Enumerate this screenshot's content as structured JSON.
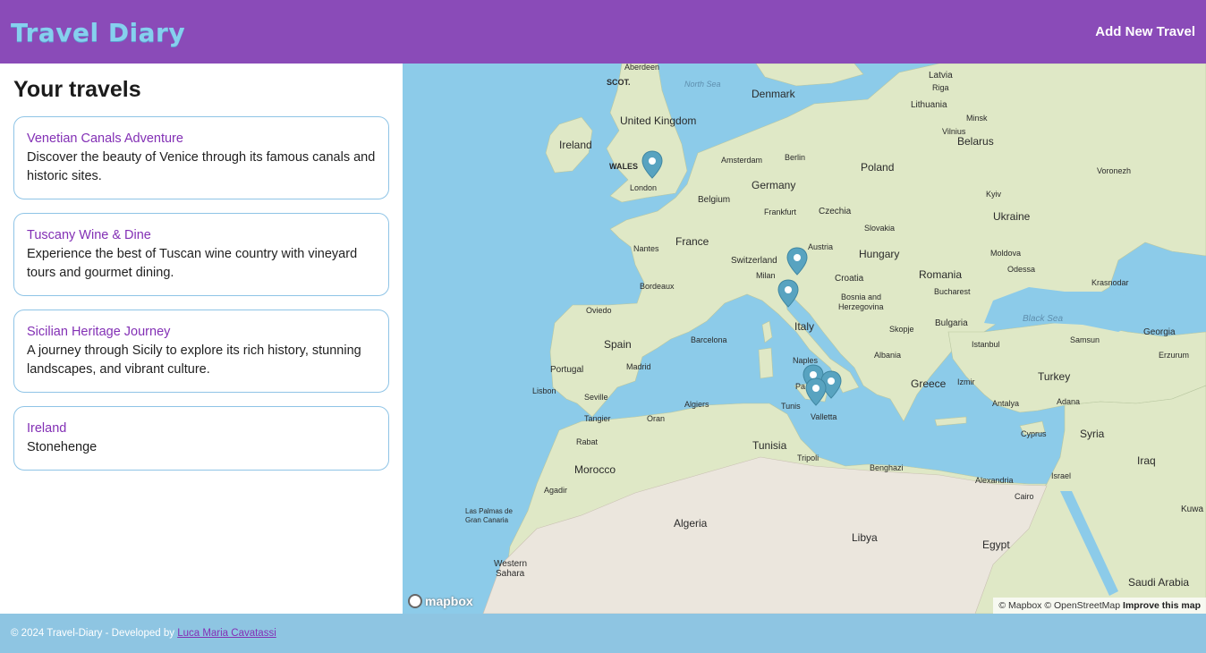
{
  "header": {
    "logo": "Travel Diary",
    "add_label": "Add New Travel"
  },
  "sidebar": {
    "heading": "Your travels",
    "travels": [
      {
        "title": "Venetian Canals Adventure",
        "description": "Discover the beauty of Venice through its famous canals and historic sites."
      },
      {
        "title": "Tuscany Wine & Dine",
        "description": "Experience the best of Tuscan wine country with vineyard tours and gourmet dining."
      },
      {
        "title": "Sicilian Heritage Journey",
        "description": "A journey through Sicily to explore its rich history, stunning landscapes, and vibrant culture."
      },
      {
        "title": "Ireland",
        "description": "Stonehenge"
      }
    ]
  },
  "map": {
    "logo": "mapbox",
    "attribution": "© Mapbox © OpenStreetMap",
    "improve": "Improve this map",
    "labels": {
      "countries": [
        "Ireland",
        "United Kingdom",
        "France",
        "Spain",
        "Portugal",
        "Germany",
        "Denmark",
        "Poland",
        "Belarus",
        "Ukraine",
        "Lithuania",
        "Latvia",
        "Czechia",
        "Slovakia",
        "Austria",
        "Hungary",
        "Romania",
        "Moldova",
        "Switzerland",
        "Italy",
        "Croatia",
        "Bosnia and Herzegovina",
        "Bulgaria",
        "Greece",
        "Turkey",
        "Syria",
        "Iraq",
        "Cyprus",
        "Israel",
        "Egypt",
        "Libya",
        "Tunisia",
        "Algeria",
        "Morocco",
        "Western Sahara",
        "Saudi Arabia",
        "Belgium",
        "Albania",
        "Georgia",
        "Kuwa"
      ],
      "cities": [
        "London",
        "Amsterdam",
        "Berlin",
        "Frankfurt",
        "Nantes",
        "Bordeaux",
        "Milan",
        "Oviedo",
        "Barcelona",
        "Madrid",
        "Lisbon",
        "Seville",
        "Tangier",
        "Oran",
        "Algiers",
        "Rabat",
        "Agadir",
        "Las Palmas de Gran Canaria",
        "Naples",
        "Palermo",
        "Tunis",
        "Valletta",
        "Tripoli",
        "Benghazi",
        "Alexandria",
        "Cairo",
        "Istanbul",
        "Izmir",
        "Antalya",
        "Adana",
        "Samsun",
        "Erzurum",
        "Bucharest",
        "Kyiv",
        "Krasnodar",
        "Voronezh",
        "Skopje",
        "Aberdeen",
        "Vilnius",
        "Riga",
        "Minsk",
        "Odessa"
      ],
      "regions": [
        "SCOT.",
        "WALES",
        "North Sea",
        "Black Sea"
      ]
    }
  },
  "footer": {
    "copyright": "© 2024 Travel-Diary   -   Developed by",
    "author": "Luca Maria Cavatassi"
  }
}
